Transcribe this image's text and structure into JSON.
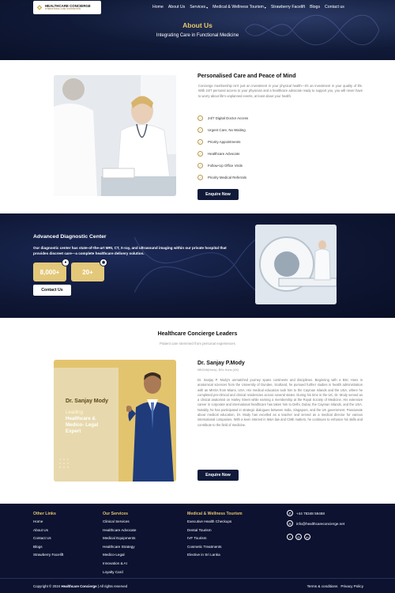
{
  "colors": {
    "accent": "#e3c46e",
    "navy": "#121a3a",
    "dark_bg": "#0c1230"
  },
  "brand": {
    "name": "HEALTHCARE CONCIERGE",
    "tagline": "INTERNATIONAL CARE COORDINATION"
  },
  "nav": [
    {
      "label": "Home",
      "dropdown": false
    },
    {
      "label": "About Us",
      "dropdown": false
    },
    {
      "label": "Services",
      "dropdown": true
    },
    {
      "label": "Medical & Wellness Tourism",
      "dropdown": true
    },
    {
      "label": "Strawberry Facelift",
      "dropdown": false
    },
    {
      "label": "Blogs",
      "dropdown": false
    },
    {
      "label": "Contact us",
      "dropdown": false
    }
  ],
  "hero": {
    "title": "About Us",
    "subtitle": "Integrating Care in Functional Medicine"
  },
  "peace": {
    "title": "Personalised Care and Peace of Mind",
    "paragraph": "Concierge membership isn't just an investment in your physical health—it's an investment in your quality of life. With 24/7 personal access to your physician and a healthcare advocate ready to support you, you will never have to worry about life's unplanned events, at least about your health.",
    "features": [
      "24/7 Digital Doctor Access",
      "Urgent Care, No Waiting",
      "Priority Appointments",
      "Healthcare Advocate",
      "Follow-Up Office Visits",
      "Priority Medical Referrals"
    ],
    "cta": "Enquire Now"
  },
  "diagnostic": {
    "title": "Advanced Diagnostic Center",
    "description": "Our diagnostic center has state-of-the-art MRI, CT, X-ray, and ultrasound imaging within our private hospital that provides discreet care—a complete healthcare delivery solution.",
    "stats": [
      {
        "value": "8,000+",
        "badge_icon": "user-icon"
      },
      {
        "value": "20+",
        "badge_icon": "eye-icon"
      }
    ],
    "cta": "Contact Us"
  },
  "leaders": {
    "title": "Healthcare Concierge Leaders",
    "subtitle": "Patient care stemmed from personal experiences",
    "card": {
      "name": "Dr. Sanjay Mody",
      "role_line1": "Leading",
      "role_line2": "Healthcare &",
      "role_line3": "Medico- Legal",
      "role_line4": "Expert"
    },
    "doctor_name": "Dr. Sanjay P.Mody",
    "credentials": "MBChB(Hons), BSc Hons (UK)",
    "bio": "Dr. Sanjay P. Mody's unmatched journey spans continents and disciplines. Beginning with a BSc Hons in anatomical sciences from the University of Dundee, Scotland, he pursued further studies in health administration with an MHSA from Miami, USA. His medical education took him to the Cayman Islands and the USA, where he completed pre-clinical and clinical residencies across several states. During his time in the UK, Dr. Mody served as a clinical anatomist on Harley Street while earning a membership at the Royal Society of Medicine. His extensive career in corporate and international healthcare has taken him to Delhi, Dubai, the Cayman Islands, and the USA. Notably, he has participated in strategic dialogues between India, Singapore, and the UK government. Passionate about medical education, Dr. Mody has excelled as a teacher and served as a medical director for various international companies. With a keen interest in M&A law and CME matters, he continues to enhance his skills and contribute to the field of medicine.",
    "cta": "Enquire Now"
  },
  "footer": {
    "other_links": {
      "title": "Other Links",
      "items": [
        "Home",
        "About Us",
        "Contact Us",
        "Blogs",
        "Strawberry Facelift"
      ]
    },
    "services": {
      "title": "Our Services",
      "items": [
        "Clinical Services",
        "Healthcare Advocate",
        "Medical Equipments",
        "Healthcare Strategy",
        "Medico-Legal",
        "Innovation & AI",
        "Loyalty Card"
      ]
    },
    "tourism": {
      "title": "Medical & Wellness Tourism",
      "items": [
        "Executive Health Checkups",
        "Dental Tourism",
        "IVF Tourism",
        "Cosmetic Treatments",
        "Elective in Sri Lanka"
      ]
    },
    "phone": "+44 78348 59468",
    "email": "info@healthcareconcierge.net",
    "social": [
      "f",
      "◎",
      "in"
    ],
    "copyright_prefix": "Copyright © 2024",
    "copyright_brand": "Healthcare Concierge",
    "copyright_suffix": "| All rights reserved",
    "terms": "Terms & conditions",
    "privacy": "Privacy Policy"
  }
}
